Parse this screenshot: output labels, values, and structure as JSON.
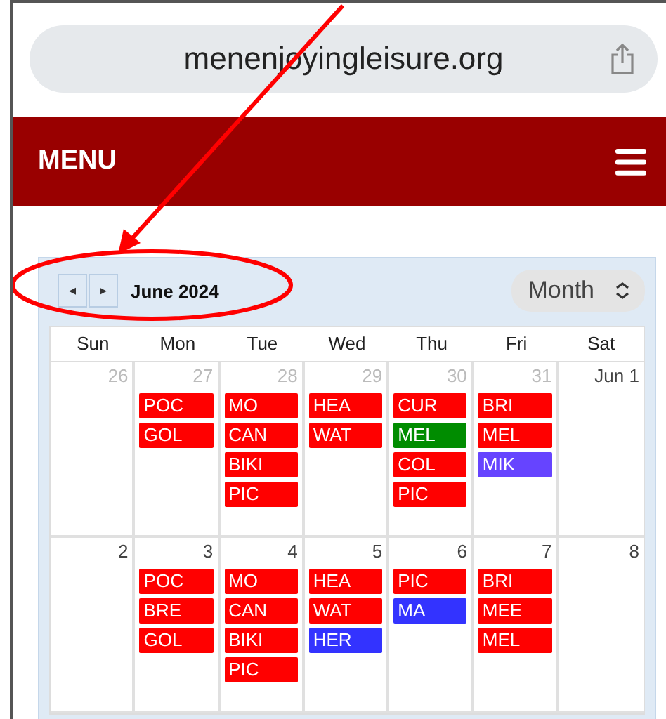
{
  "address_bar": {
    "url": "menenjoyingleisure.org"
  },
  "nav_bar": {
    "title": "MENU"
  },
  "calendar": {
    "prev": "◂",
    "next": "▸",
    "title": "June 2024",
    "view": "Month",
    "weekdays": [
      "Sun",
      "Mon",
      "Tue",
      "Wed",
      "Thu",
      "Fri",
      "Sat"
    ],
    "weeks": [
      [
        {
          "day": "26",
          "other_month": true
        },
        {
          "day": "27",
          "other_month": true,
          "events": [
            {
              "label": "POC",
              "color": "#ff0000"
            },
            {
              "label": "GOL",
              "color": "#ff0000"
            }
          ]
        },
        {
          "day": "28",
          "other_month": true,
          "events": [
            {
              "label": "MO",
              "color": "#ff0000"
            },
            {
              "label": "CAN",
              "color": "#ff0000"
            },
            {
              "label": "BIKI",
              "color": "#ff0000"
            },
            {
              "label": "PIC",
              "color": "#ff0000"
            }
          ]
        },
        {
          "day": "29",
          "other_month": true,
          "events": [
            {
              "label": "HEA",
              "color": "#ff0000"
            },
            {
              "label": "WAT",
              "color": "#ff0000"
            }
          ]
        },
        {
          "day": "30",
          "other_month": true,
          "events": [
            {
              "label": "CUR",
              "color": "#ff0000"
            },
            {
              "label": "MEL",
              "color": "#008c00"
            },
            {
              "label": "COL",
              "color": "#ff0000"
            },
            {
              "label": "PIC",
              "color": "#ff0000"
            }
          ]
        },
        {
          "day": "31",
          "other_month": true,
          "events": [
            {
              "label": "BRI",
              "color": "#ff0000"
            },
            {
              "label": "MEL",
              "color": "#ff0000"
            },
            {
              "label": "MIK",
              "color": "#6644ff"
            }
          ]
        },
        {
          "day": "Jun 1",
          "other_month": false
        }
      ],
      [
        {
          "day": "2",
          "other_month": false
        },
        {
          "day": "3",
          "other_month": false,
          "events": [
            {
              "label": "POC",
              "color": "#ff0000"
            },
            {
              "label": "BRE",
              "color": "#ff0000"
            },
            {
              "label": "GOL",
              "color": "#ff0000"
            }
          ]
        },
        {
          "day": "4",
          "other_month": false,
          "events": [
            {
              "label": "MO",
              "color": "#ff0000"
            },
            {
              "label": "CAN",
              "color": "#ff0000"
            },
            {
              "label": "BIKI",
              "color": "#ff0000"
            },
            {
              "label": "PIC",
              "color": "#ff0000"
            }
          ]
        },
        {
          "day": "5",
          "other_month": false,
          "events": [
            {
              "label": "HEA",
              "color": "#ff0000"
            },
            {
              "label": "WAT",
              "color": "#ff0000"
            },
            {
              "label": "HER",
              "color": "#3333ff"
            }
          ]
        },
        {
          "day": "6",
          "other_month": false,
          "events": [
            {
              "label": "PIC",
              "color": "#ff0000"
            },
            {
              "label": "MA",
              "color": "#3333ff"
            }
          ]
        },
        {
          "day": "7",
          "other_month": false,
          "events": [
            {
              "label": "BRI",
              "color": "#ff0000"
            },
            {
              "label": "MEE",
              "color": "#ff0000"
            },
            {
              "label": "MEL",
              "color": "#ff0000"
            }
          ]
        },
        {
          "day": "8",
          "other_month": false
        }
      ]
    ]
  }
}
